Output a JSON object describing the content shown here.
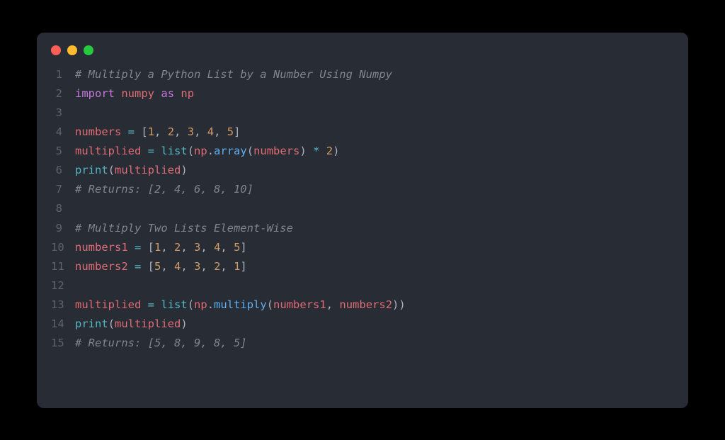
{
  "colors": {
    "bg": "#000000",
    "window_bg": "#282c34",
    "traffic_red": "#ff5f56",
    "traffic_yellow": "#ffbd2e",
    "traffic_green": "#27c93f",
    "lineno": "#5c6370",
    "default": "#abb2bf",
    "comment": "#7f848e",
    "keyword": "#c678dd",
    "module": "#e06c75",
    "var": "#e06c75",
    "operator": "#56b6c2",
    "func": "#61afef",
    "builtin": "#56b6c2",
    "number": "#d19a66"
  },
  "lines": [
    {
      "n": 1,
      "tokens": [
        {
          "t": "# Multiply a Python List by a Number Using Numpy",
          "c": "c-comment"
        }
      ]
    },
    {
      "n": 2,
      "tokens": [
        {
          "t": "import",
          "c": "c-keyword"
        },
        {
          "t": " ",
          "c": "c-punc"
        },
        {
          "t": "numpy",
          "c": "c-module"
        },
        {
          "t": " ",
          "c": "c-punc"
        },
        {
          "t": "as",
          "c": "c-keyword"
        },
        {
          "t": " ",
          "c": "c-punc"
        },
        {
          "t": "np",
          "c": "c-module"
        }
      ]
    },
    {
      "n": 3,
      "tokens": []
    },
    {
      "n": 4,
      "tokens": [
        {
          "t": "numbers",
          "c": "c-var"
        },
        {
          "t": " ",
          "c": "c-punc"
        },
        {
          "t": "=",
          "c": "c-op"
        },
        {
          "t": " [",
          "c": "c-punc"
        },
        {
          "t": "1",
          "c": "c-num"
        },
        {
          "t": ", ",
          "c": "c-punc"
        },
        {
          "t": "2",
          "c": "c-num"
        },
        {
          "t": ", ",
          "c": "c-punc"
        },
        {
          "t": "3",
          "c": "c-num"
        },
        {
          "t": ", ",
          "c": "c-punc"
        },
        {
          "t": "4",
          "c": "c-num"
        },
        {
          "t": ", ",
          "c": "c-punc"
        },
        {
          "t": "5",
          "c": "c-num"
        },
        {
          "t": "]",
          "c": "c-punc"
        }
      ]
    },
    {
      "n": 5,
      "tokens": [
        {
          "t": "multiplied",
          "c": "c-var"
        },
        {
          "t": " ",
          "c": "c-punc"
        },
        {
          "t": "=",
          "c": "c-op"
        },
        {
          "t": " ",
          "c": "c-punc"
        },
        {
          "t": "list",
          "c": "c-builtin"
        },
        {
          "t": "(",
          "c": "c-punc"
        },
        {
          "t": "np",
          "c": "c-var"
        },
        {
          "t": ".",
          "c": "c-punc"
        },
        {
          "t": "array",
          "c": "c-func"
        },
        {
          "t": "(",
          "c": "c-punc"
        },
        {
          "t": "numbers",
          "c": "c-var"
        },
        {
          "t": ") ",
          "c": "c-punc"
        },
        {
          "t": "*",
          "c": "c-op"
        },
        {
          "t": " ",
          "c": "c-punc"
        },
        {
          "t": "2",
          "c": "c-num"
        },
        {
          "t": ")",
          "c": "c-punc"
        }
      ]
    },
    {
      "n": 6,
      "tokens": [
        {
          "t": "print",
          "c": "c-builtin"
        },
        {
          "t": "(",
          "c": "c-punc"
        },
        {
          "t": "multiplied",
          "c": "c-var"
        },
        {
          "t": ")",
          "c": "c-punc"
        }
      ]
    },
    {
      "n": 7,
      "tokens": [
        {
          "t": "# Returns: [2, 4, 6, 8, 10]",
          "c": "c-comment"
        }
      ]
    },
    {
      "n": 8,
      "tokens": []
    },
    {
      "n": 9,
      "tokens": [
        {
          "t": "# Multiply Two Lists Element-Wise",
          "c": "c-comment"
        }
      ]
    },
    {
      "n": 10,
      "tokens": [
        {
          "t": "numbers1",
          "c": "c-var"
        },
        {
          "t": " ",
          "c": "c-punc"
        },
        {
          "t": "=",
          "c": "c-op"
        },
        {
          "t": " [",
          "c": "c-punc"
        },
        {
          "t": "1",
          "c": "c-num"
        },
        {
          "t": ", ",
          "c": "c-punc"
        },
        {
          "t": "2",
          "c": "c-num"
        },
        {
          "t": ", ",
          "c": "c-punc"
        },
        {
          "t": "3",
          "c": "c-num"
        },
        {
          "t": ", ",
          "c": "c-punc"
        },
        {
          "t": "4",
          "c": "c-num"
        },
        {
          "t": ", ",
          "c": "c-punc"
        },
        {
          "t": "5",
          "c": "c-num"
        },
        {
          "t": "]",
          "c": "c-punc"
        }
      ]
    },
    {
      "n": 11,
      "tokens": [
        {
          "t": "numbers2",
          "c": "c-var"
        },
        {
          "t": " ",
          "c": "c-punc"
        },
        {
          "t": "=",
          "c": "c-op"
        },
        {
          "t": " [",
          "c": "c-punc"
        },
        {
          "t": "5",
          "c": "c-num"
        },
        {
          "t": ", ",
          "c": "c-punc"
        },
        {
          "t": "4",
          "c": "c-num"
        },
        {
          "t": ", ",
          "c": "c-punc"
        },
        {
          "t": "3",
          "c": "c-num"
        },
        {
          "t": ", ",
          "c": "c-punc"
        },
        {
          "t": "2",
          "c": "c-num"
        },
        {
          "t": ", ",
          "c": "c-punc"
        },
        {
          "t": "1",
          "c": "c-num"
        },
        {
          "t": "]",
          "c": "c-punc"
        }
      ]
    },
    {
      "n": 12,
      "tokens": []
    },
    {
      "n": 13,
      "tokens": [
        {
          "t": "multiplied",
          "c": "c-var"
        },
        {
          "t": " ",
          "c": "c-punc"
        },
        {
          "t": "=",
          "c": "c-op"
        },
        {
          "t": " ",
          "c": "c-punc"
        },
        {
          "t": "list",
          "c": "c-builtin"
        },
        {
          "t": "(",
          "c": "c-punc"
        },
        {
          "t": "np",
          "c": "c-var"
        },
        {
          "t": ".",
          "c": "c-punc"
        },
        {
          "t": "multiply",
          "c": "c-func"
        },
        {
          "t": "(",
          "c": "c-punc"
        },
        {
          "t": "numbers1",
          "c": "c-var"
        },
        {
          "t": ", ",
          "c": "c-punc"
        },
        {
          "t": "numbers2",
          "c": "c-var"
        },
        {
          "t": "))",
          "c": "c-punc"
        }
      ]
    },
    {
      "n": 14,
      "tokens": [
        {
          "t": "print",
          "c": "c-builtin"
        },
        {
          "t": "(",
          "c": "c-punc"
        },
        {
          "t": "multiplied",
          "c": "c-var"
        },
        {
          "t": ")",
          "c": "c-punc"
        }
      ]
    },
    {
      "n": 15,
      "tokens": [
        {
          "t": "# Returns: [5, 8, 9, 8, 5]",
          "c": "c-comment"
        }
      ]
    }
  ]
}
